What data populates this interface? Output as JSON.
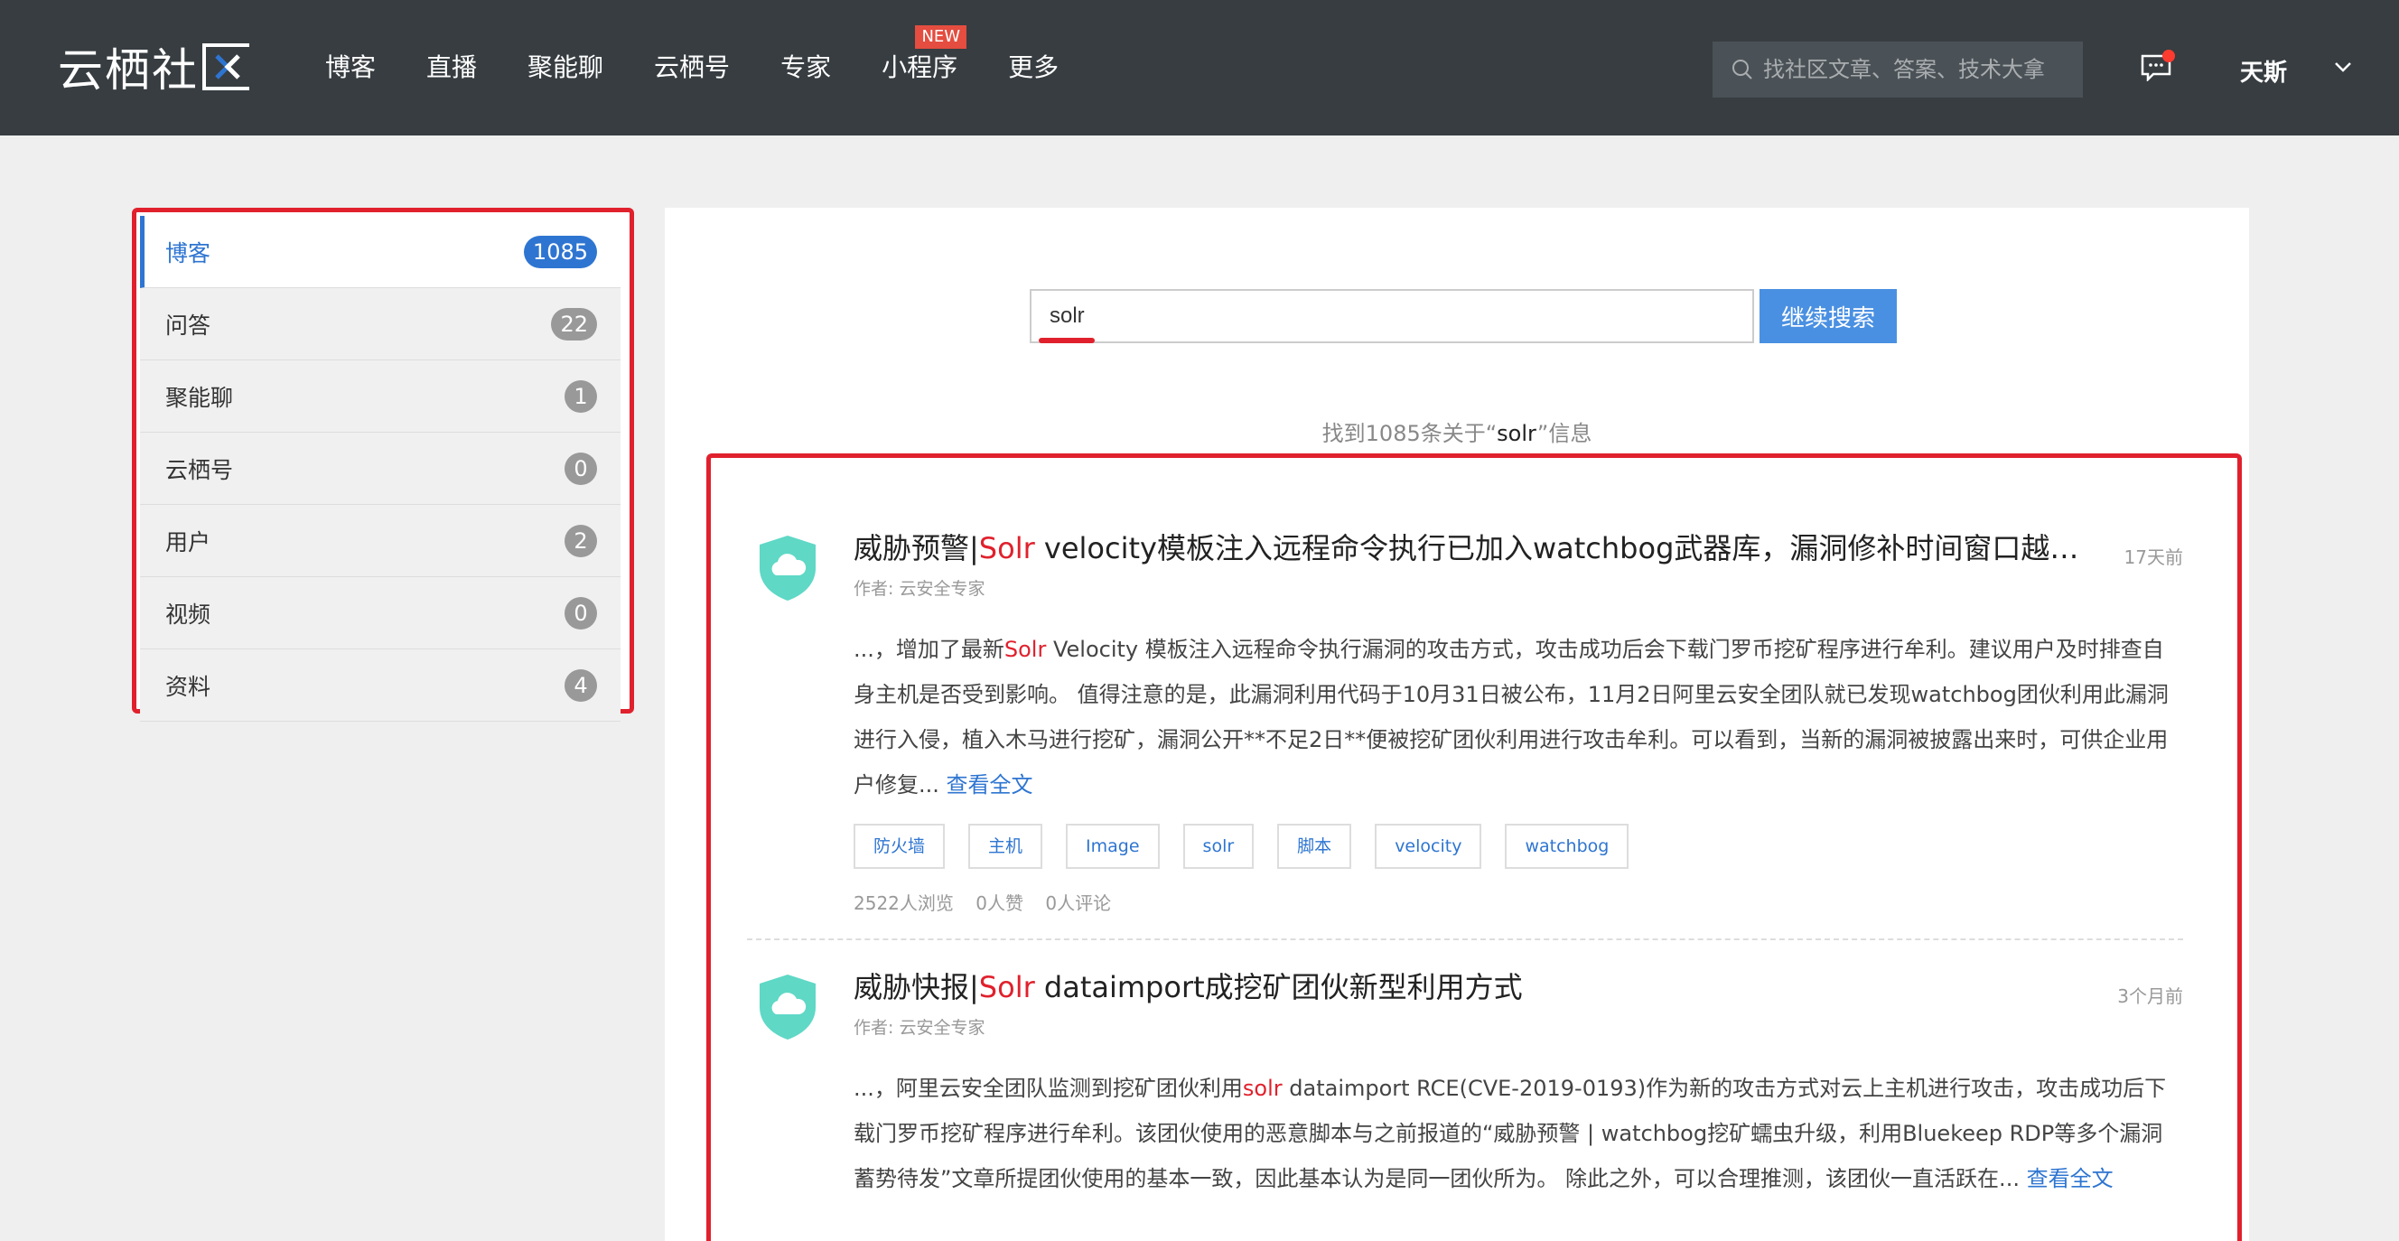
{
  "header": {
    "logo_text": "云栖社",
    "nav": [
      {
        "label": "博客"
      },
      {
        "label": "直播"
      },
      {
        "label": "聚能聊"
      },
      {
        "label": "云栖号"
      },
      {
        "label": "专家"
      },
      {
        "label": "小程序",
        "badge": "NEW"
      },
      {
        "label": "更多"
      }
    ],
    "search_placeholder": "找社区文章、答案、技术大拿",
    "username": "天斯",
    "icons": {
      "search": "search-icon",
      "message": "message-icon",
      "menu": "chevron-down-icon"
    }
  },
  "sidebar": {
    "items": [
      {
        "label": "博客",
        "count": "1085",
        "active": true
      },
      {
        "label": "问答",
        "count": "22"
      },
      {
        "label": "聚能聊",
        "count": "1"
      },
      {
        "label": "云栖号",
        "count": "0"
      },
      {
        "label": "用户",
        "count": "2"
      },
      {
        "label": "视频",
        "count": "0"
      },
      {
        "label": "资料",
        "count": "4"
      }
    ]
  },
  "search": {
    "query": "solr",
    "button": "继续搜索",
    "info_prefix": "找到1085条关于“",
    "info_keyword": "solr",
    "info_suffix": "”信息"
  },
  "results": [
    {
      "title_prefix": "威胁预警|",
      "title_hl": "Solr",
      "title_rest": " velocity模板注入远程命令执行已加入watchbog武器库，漏洞修补时间窗口越来越短",
      "author": "作者: 云安全专家",
      "time": "17天前",
      "body_prefix": "...，增加了最新",
      "body_hl": "Solr",
      "body_rest": " Velocity 模板注入远程命令执行漏洞的攻击方式，攻击成功后会下载门罗币挖矿程序进行牟利。建议用户及时排查自身主机是否受到影响。 值得注意的是，此漏洞利用代码于10月31日被公布，11月2日阿里云安全团队就已发现watchbog团伙利用此漏洞进行入侵，植入木马进行挖矿，漏洞公开**不足2日**便被挖矿团伙利用进行攻击牟利。可以看到，当新的漏洞被披露出来时，可供企业用户修复...",
      "read_more": "查看全文",
      "tags": [
        "防火墙",
        "主机",
        "Image",
        "solr",
        "脚本",
        "velocity",
        "watchbog"
      ],
      "views": "2522人浏览",
      "likes": "0人赞",
      "comments": "0人评论"
    },
    {
      "title_prefix": "威胁快报|",
      "title_hl": "Solr",
      "title_rest": " dataimport成挖矿团伙新型利用方式",
      "author": "作者: 云安全专家",
      "time": "3个月前",
      "body_prefix": "...，阿里云安全团队监测到挖矿团伙利用",
      "body_hl": "solr",
      "body_rest": " dataimport RCE(CVE-2019-0193)作为新的攻击方式对云上主机进行攻击，攻击成功后下载门罗币挖矿程序进行牟利。该团伙使用的恶意脚本与之前报道的“威胁预警 | watchbog挖矿蠕虫升级，利用Bluekeep RDP等多个漏洞蓄势待发”文章所提团伙使用的基本一致，因此基本认为是同一团伙所为。 除此之外，可以合理推测，该团伙一直活跃在...",
      "read_more": "查看全文"
    }
  ]
}
